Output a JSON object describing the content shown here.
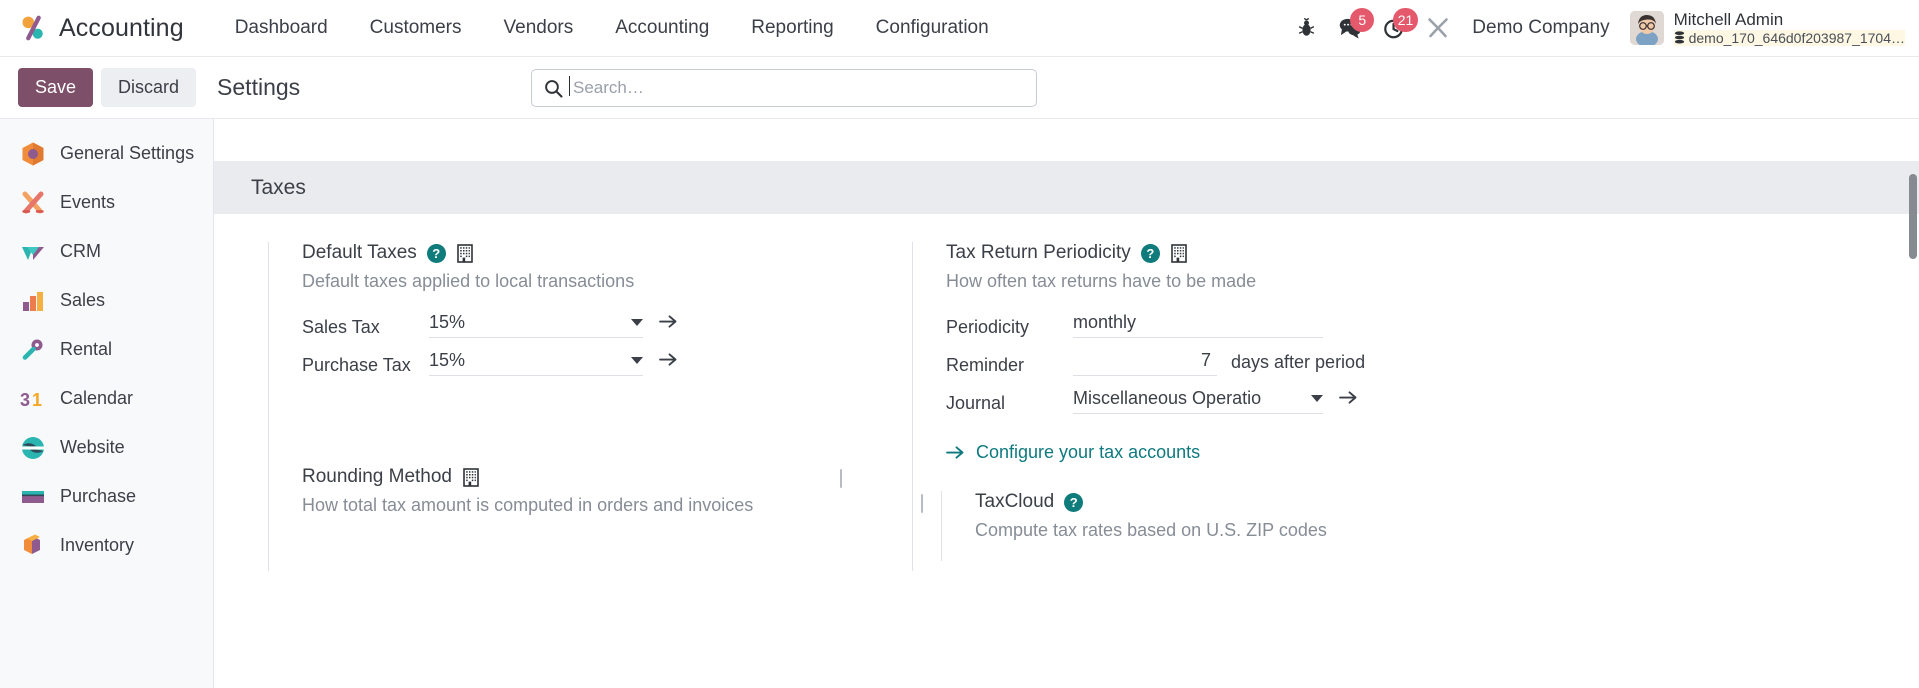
{
  "app": {
    "name": "Accounting",
    "logo_colors": {
      "orange": "#f2a23c",
      "purple": "#8f5a8e",
      "teal": "#2bb5b0"
    }
  },
  "navbar": {
    "menu": [
      {
        "label": "Dashboard"
      },
      {
        "label": "Customers"
      },
      {
        "label": "Vendors"
      },
      {
        "label": "Accounting"
      },
      {
        "label": "Reporting"
      },
      {
        "label": "Configuration"
      }
    ],
    "icons": {
      "bug": "bug-icon",
      "chat": "chat-icon",
      "activity": "clock-icon",
      "tools": "wrench-icon"
    },
    "badges": {
      "chat_count": "5",
      "activity_count": "21",
      "badge_color": "#e4596b"
    },
    "company": "Demo Company",
    "user": {
      "name": "Mitchell Admin",
      "database": "demo_170_646d0f203987_1704…"
    }
  },
  "controlbar": {
    "save_label": "Save",
    "discard_label": "Discard",
    "title": "Settings",
    "save_color": "#7d4f69"
  },
  "search": {
    "placeholder": "Search…",
    "value": ""
  },
  "sidebar": {
    "items": [
      {
        "label": "General Settings",
        "icon": "general-settings-icon"
      },
      {
        "label": "Events",
        "icon": "events-icon"
      },
      {
        "label": "CRM",
        "icon": "crm-icon"
      },
      {
        "label": "Sales",
        "icon": "sales-icon"
      },
      {
        "label": "Rental",
        "icon": "rental-icon"
      },
      {
        "label": "Calendar",
        "icon": "calendar-icon"
      },
      {
        "label": "Website",
        "icon": "website-icon"
      },
      {
        "label": "Purchase",
        "icon": "purchase-icon"
      },
      {
        "label": "Inventory",
        "icon": "inventory-icon"
      }
    ]
  },
  "settings": {
    "section_title": "Taxes",
    "default_taxes": {
      "title": "Default Taxes",
      "subtitle": "Default taxes applied to local transactions",
      "sales_tax_label": "Sales Tax",
      "sales_tax_value": "15%",
      "purchase_tax_label": "Purchase Tax",
      "purchase_tax_value": "15%"
    },
    "tax_return_periodicity": {
      "title": "Tax Return Periodicity",
      "subtitle": "How often tax returns have to be made",
      "periodicity_label": "Periodicity",
      "periodicity_value": "monthly",
      "reminder_label": "Reminder",
      "reminder_value": "7",
      "reminder_suffix": "days after period",
      "journal_label": "Journal",
      "journal_value": "Miscellaneous Operatio",
      "configure_link": "Configure your tax accounts"
    },
    "rounding_method": {
      "title": "Rounding Method",
      "subtitle": "How total tax amount is computed in orders and invoices",
      "checked": false
    },
    "taxcloud": {
      "title": "TaxCloud",
      "subtitle": "Compute tax rates based on U.S. ZIP codes",
      "checked": false
    }
  }
}
